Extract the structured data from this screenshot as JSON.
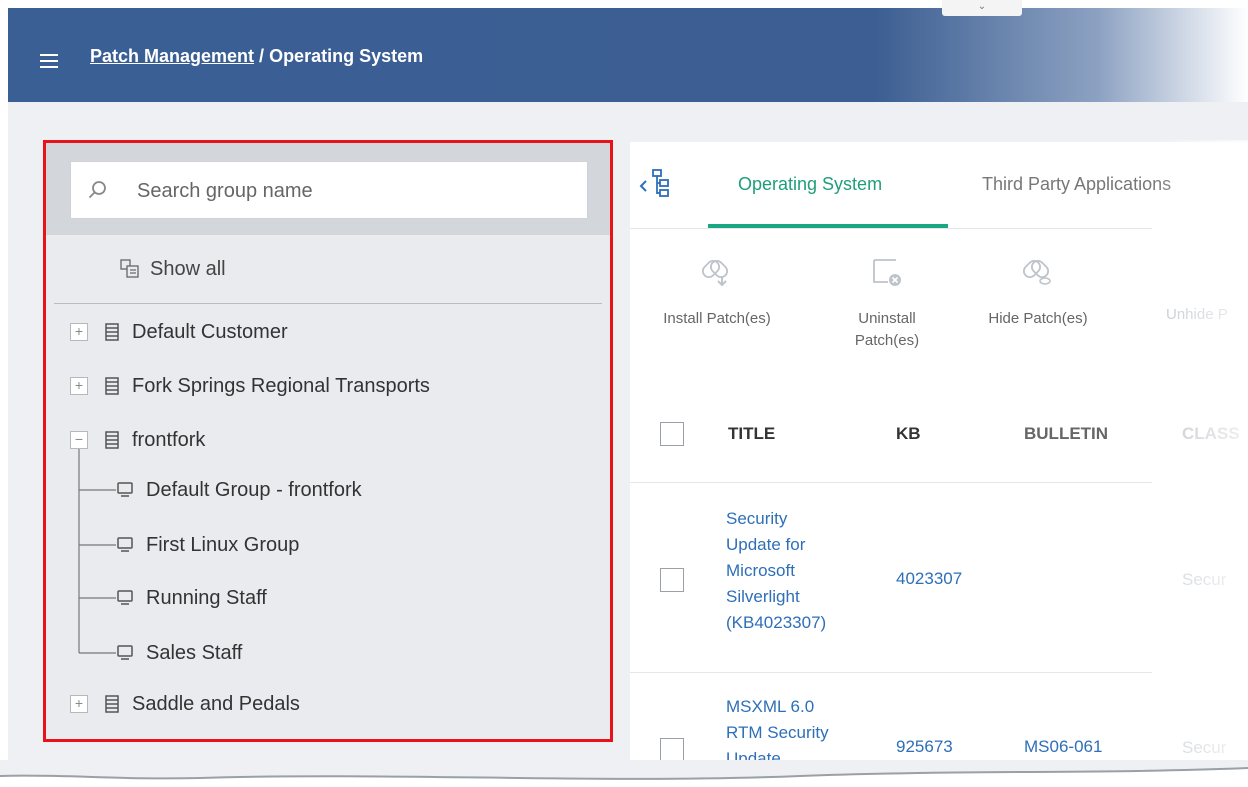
{
  "header": {
    "breadcrumb_link": "Patch Management",
    "breadcrumb_separator": " / ",
    "breadcrumb_current": "Operating System",
    "collapse_tab": "⌄"
  },
  "sidebar": {
    "search_placeholder": "Search group name",
    "show_all": "Show all",
    "tree": {
      "default_customer": {
        "expander": "+",
        "label": "Default Customer"
      },
      "fork_springs": {
        "expander": "+",
        "label": "Fork Springs Regional Transports"
      },
      "frontfork": {
        "expander": "−",
        "label": "frontfork"
      },
      "default_group": {
        "label": "Default Group - frontfork"
      },
      "first_linux": {
        "label": "First Linux Group"
      },
      "running_staff": {
        "label": "Running Staff"
      },
      "sales_staff": {
        "label": "Sales Staff"
      },
      "saddle_pedals": {
        "expander": "+",
        "label": "Saddle and Pedals"
      }
    }
  },
  "main": {
    "tabs": {
      "os": "Operating System",
      "third_party": "Third Party Applications"
    },
    "toolbar": {
      "install_label": "Install Patch(es)",
      "uninstall_line1": "Uninstall",
      "uninstall_line2": "Patch(es)",
      "hide_label": "Hide Patch(es)",
      "unhide_label": "Unhide P"
    },
    "table": {
      "headers": {
        "title": "TITLE",
        "kb": "KB",
        "bulletin": "BULLETIN",
        "classification": "CLASS"
      },
      "rows": [
        {
          "title_lines": [
            "Security",
            "Update for",
            "Microsoft",
            "Silverlight",
            "(KB4023307)"
          ],
          "kb": "4023307",
          "bulletin": "",
          "classification": "Secur"
        },
        {
          "title_lines": [
            "MSXML 6.0",
            "RTM Security",
            "Update"
          ],
          "kb": "925673",
          "bulletin": "MS06-061",
          "classification": "Secur"
        }
      ]
    }
  },
  "colors": {
    "header_blue": "#3a5f95",
    "active_tab": "#1f9e7a",
    "link_blue": "#2e6fb8",
    "highlight_red": "#e8121b"
  }
}
